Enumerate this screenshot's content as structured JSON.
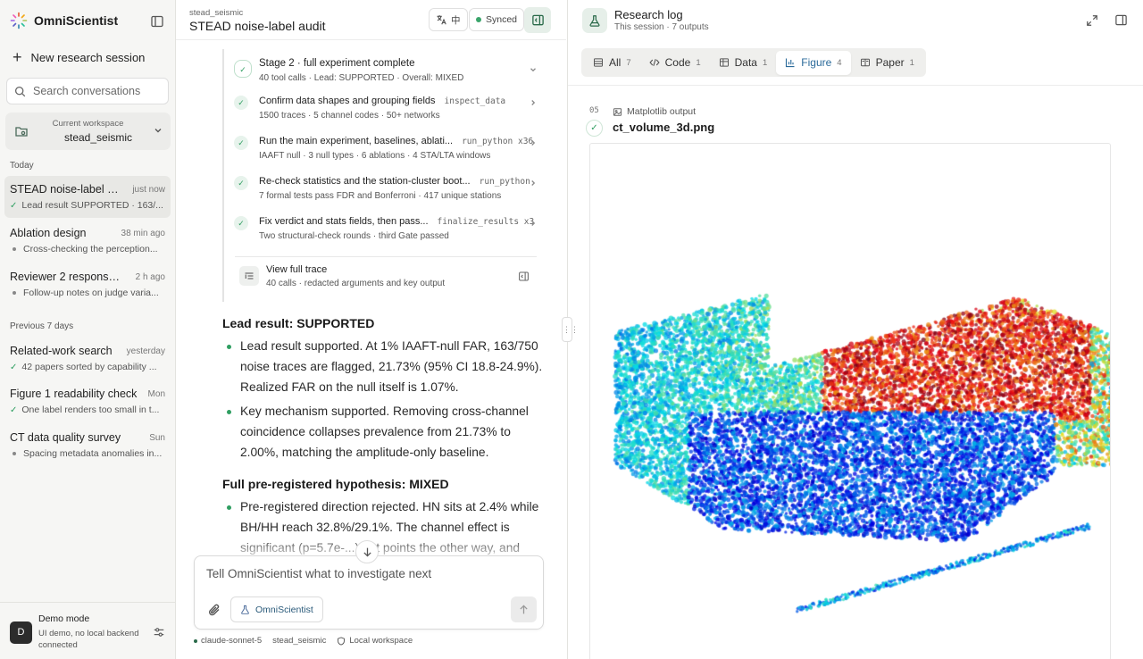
{
  "sidebar": {
    "brand": "OmniScientist",
    "new_session": "New research session",
    "search_placeholder": "Search conversations",
    "workspace": {
      "label": "Current workspace",
      "value": "stead_seismic"
    },
    "section_today": "Today",
    "section_prev": "Previous 7 days",
    "today": [
      {
        "title": "STEAD noise-label au...",
        "time": "just now",
        "status": "Lead result SUPPORTED · 163/...",
        "done": true
      },
      {
        "title": "Ablation design",
        "time": "38 min ago",
        "status": "Cross-checking the perception...",
        "done": false
      },
      {
        "title": "Reviewer 2 response ...",
        "time": "2 h ago",
        "status": "Follow-up notes on judge varia...",
        "done": false
      }
    ],
    "previous": [
      {
        "title": "Related-work search",
        "time": "yesterday",
        "status": "42 papers sorted by capability ...",
        "done": true
      },
      {
        "title": "Figure 1 readability check",
        "time": "Mon",
        "status": "One label renders too small in t...",
        "done": true
      },
      {
        "title": "CT data quality survey",
        "time": "Sun",
        "status": "Spacing metadata anomalies in...",
        "done": false
      }
    ],
    "demo": {
      "avatar": "D",
      "title": "Demo mode",
      "subtitle": "UI demo, no local backend connected"
    }
  },
  "chat": {
    "workspace": "stead_seismic",
    "title": "STEAD noise-label audit",
    "lang_label": "中",
    "sync_label": "Synced",
    "stage": {
      "title": "Stage 2 · full experiment complete",
      "summary": "40 tool calls · Lead: SUPPORTED · Overall: MIXED",
      "steps": [
        {
          "title": "Confirm data shapes and grouping fields",
          "tool": "inspect_data",
          "sub": "1500 traces · 5 channel codes · 50+ networks"
        },
        {
          "title": "Run the main experiment, baselines, ablati...",
          "tool": "run_python x36",
          "sub": "IAAFT null · 3 null types · 6 ablations · 4 STA/LTA windows"
        },
        {
          "title": "Re-check statistics and the station-cluster boot...",
          "tool": "run_python",
          "sub": "7 formal tests pass FDR and Bonferroni · 417 unique stations"
        },
        {
          "title": "Fix verdict and stats fields, then pass...",
          "tool": "finalize_results x3",
          "sub": "Two structural-check rounds · third Gate passed"
        }
      ],
      "trace_title": "View full trace",
      "trace_sub": "40 calls · redacted arguments and key output"
    },
    "lead_heading": "Lead result: SUPPORTED",
    "lead_bullets": [
      "Lead result supported. At 1% IAAFT-null FAR, 163/750 noise traces are flagged, 21.73% (95% CI 18.8-24.9%). Realized FAR on the null itself is 1.07%.",
      "Key mechanism supported. Removing cross-channel coincidence collapses prevalence from 21.73% to 2.00%, matching the amplitude-only baseline."
    ],
    "full_heading": "Full pre-registered hypothesis: MIXED",
    "full_bullets": [
      "Pre-registered direction rejected. HN sits at 2.4% while BH/HH reach 32.8%/29.1%. The channel effect is significant (p=5.7e-...) but points the other way, and"
    ],
    "composer_placeholder": "Tell OmniScientist what to investigate next",
    "agent_label": "OmniScientist",
    "meta": {
      "model": "claude-sonnet-5",
      "workspace": "stead_seismic",
      "location": "Local workspace"
    }
  },
  "panel": {
    "title": "Research log",
    "subtitle": "This session · 7 outputs",
    "tabs": [
      {
        "label": "All",
        "count": "7",
        "icon": "list-icon",
        "active": false
      },
      {
        "label": "Code",
        "count": "1",
        "icon": "code-icon",
        "active": false
      },
      {
        "label": "Data",
        "count": "1",
        "icon": "table-icon",
        "active": false
      },
      {
        "label": "Figure",
        "count": "4",
        "icon": "chart-icon",
        "active": true
      },
      {
        "label": "Paper",
        "count": "1",
        "icon": "book-icon",
        "active": false
      }
    ],
    "output": {
      "index": "05",
      "kind": "Matplotlib output",
      "filename": "ct_volume_3d.png"
    }
  },
  "colors": {
    "accent": "#2f9e61",
    "tab_active": "#2a6a9a"
  }
}
